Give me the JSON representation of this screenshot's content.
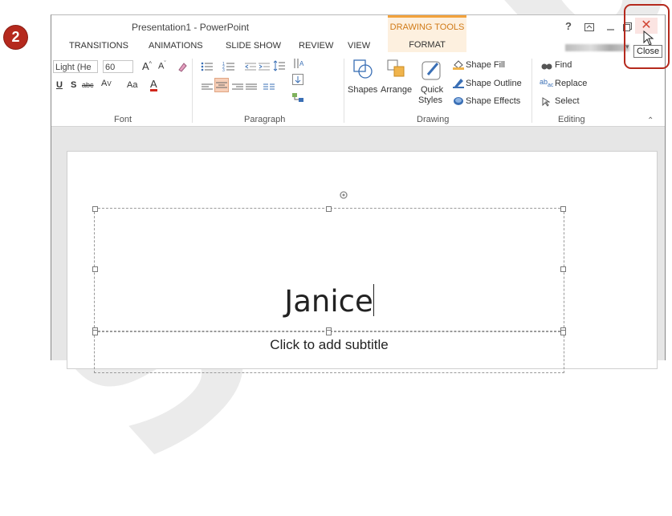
{
  "step_badge": "2",
  "window": {
    "title": "Presentation1 - PowerPoint",
    "contextual_group": "DRAWING TOOLS",
    "help": "?",
    "close_tooltip": "Close"
  },
  "tabs": [
    "TRANSITIONS",
    "ANIMATIONS",
    "SLIDE SHOW",
    "REVIEW",
    "VIEW",
    "FORMAT"
  ],
  "font": {
    "name": "Light (He",
    "size": "60",
    "group_label": "Font",
    "aa_label": "Aa"
  },
  "paragraph": {
    "group_label": "Paragraph"
  },
  "drawing": {
    "group_label": "Drawing",
    "shapes": "Shapes",
    "arrange": "Arrange",
    "quick_styles_1": "Quick",
    "quick_styles_2": "Styles",
    "shape_fill": "Shape Fill",
    "shape_outline": "Shape Outline",
    "shape_effects": "Shape Effects"
  },
  "editing": {
    "group_label": "Editing",
    "find": "Find",
    "replace": "Replace",
    "select": "Select"
  },
  "slide": {
    "title": "Janice",
    "subtitle": "Click to add subtitle"
  },
  "colors": {
    "accent_red": "#b5291d",
    "context_orange": "#f3a23b"
  }
}
